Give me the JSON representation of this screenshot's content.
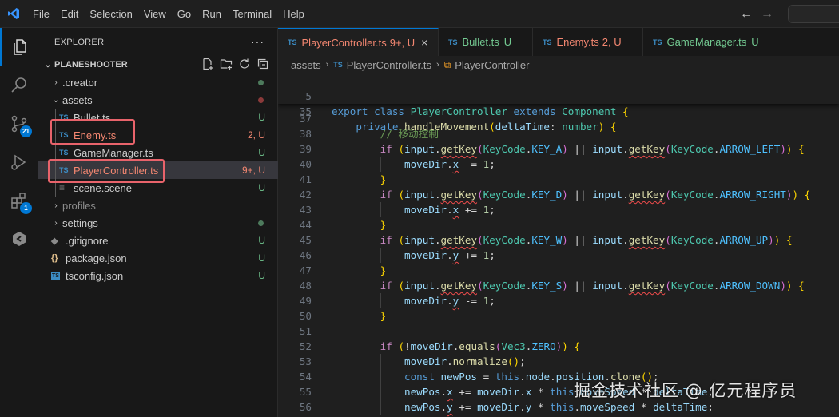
{
  "menu": [
    "File",
    "Edit",
    "Selection",
    "View",
    "Go",
    "Run",
    "Terminal",
    "Help"
  ],
  "activity": {
    "scm_badge": "21",
    "extensions_badge": "1"
  },
  "explorer": {
    "title": "EXPLORER",
    "more": "···",
    "project": "PLANESHOOTER",
    "items": [
      {
        "name": ".creator",
        "kind": "folder",
        "status": "dot"
      },
      {
        "name": "assets",
        "kind": "folder-open",
        "status": "dot-err"
      },
      {
        "name": "Bullet.ts",
        "kind": "ts",
        "status": "U"
      },
      {
        "name": "Enemy.ts",
        "kind": "ts",
        "status": "2, U"
      },
      {
        "name": "GameManager.ts",
        "kind": "ts",
        "status": "U"
      },
      {
        "name": "PlayerController.ts",
        "kind": "ts",
        "status": "9+, U"
      },
      {
        "name": "scene.scene",
        "kind": "scene",
        "status": "U"
      },
      {
        "name": "profiles",
        "kind": "folder",
        "status": ""
      },
      {
        "name": "settings",
        "kind": "folder",
        "status": "dot"
      },
      {
        "name": ".gitignore",
        "kind": "git",
        "status": "U"
      },
      {
        "name": "package.json",
        "kind": "json",
        "status": "U"
      },
      {
        "name": "tsconfig.json",
        "kind": "tsconfig",
        "status": "U"
      }
    ],
    "ts_icon": "TS",
    "json_icon": "{}"
  },
  "tabs": [
    {
      "label": "PlayerController.ts",
      "status": "9+, U",
      "close": "×"
    },
    {
      "label": "Bullet.ts",
      "status": "U"
    },
    {
      "label": "Enemy.ts",
      "status": "2, U"
    },
    {
      "label": "GameManager.ts",
      "status": "U"
    }
  ],
  "breadcrumb": [
    "assets",
    "PlayerController.ts",
    "PlayerController"
  ],
  "sticky": [
    {
      "ln": "5",
      "text": "export class PlayerController extends Component {"
    },
    {
      "ln": "35",
      "text": "    private handleMovement(deltaTime: number) {"
    }
  ],
  "code_lines": [
    {
      "ln": "37",
      "text": ""
    },
    {
      "ln": "38",
      "text": "        // 移动控制"
    },
    {
      "ln": "39",
      "text": "        if (input.getKey(KeyCode.KEY_A) || input.getKey(KeyCode.ARROW_LEFT)) {"
    },
    {
      "ln": "40",
      "text": "            moveDir.x -= 1;"
    },
    {
      "ln": "41",
      "text": "        }"
    },
    {
      "ln": "42",
      "text": "        if (input.getKey(KeyCode.KEY_D) || input.getKey(KeyCode.ARROW_RIGHT)) {"
    },
    {
      "ln": "43",
      "text": "            moveDir.x += 1;"
    },
    {
      "ln": "44",
      "text": "        }"
    },
    {
      "ln": "45",
      "text": "        if (input.getKey(KeyCode.KEY_W) || input.getKey(KeyCode.ARROW_UP)) {"
    },
    {
      "ln": "46",
      "text": "            moveDir.y += 1;"
    },
    {
      "ln": "47",
      "text": "        }"
    },
    {
      "ln": "48",
      "text": "        if (input.getKey(KeyCode.KEY_S) || input.getKey(KeyCode.ARROW_DOWN)) {"
    },
    {
      "ln": "49",
      "text": "            moveDir.y -= 1;"
    },
    {
      "ln": "50",
      "text": "        }"
    },
    {
      "ln": "51",
      "text": ""
    },
    {
      "ln": "52",
      "text": "        if (!moveDir.equals(Vec3.ZERO)) {"
    },
    {
      "ln": "53",
      "text": "            moveDir.normalize();"
    },
    {
      "ln": "54",
      "text": "            const newPos = this.node.position.clone();"
    },
    {
      "ln": "55",
      "text": "            newPos.x += moveDir.x * this.moveSpeed * deltaTime;"
    },
    {
      "ln": "56",
      "text": "            newPos.y += moveDir.y * this.moveSpeed * deltaTime;"
    }
  ],
  "watermark": "掘金技术社区 @ 亿元程序员",
  "colors": {
    "accent": "#0078d4",
    "untracked": "#73c991",
    "error": "#f14c4c",
    "highlight_box": "#e8636b"
  }
}
